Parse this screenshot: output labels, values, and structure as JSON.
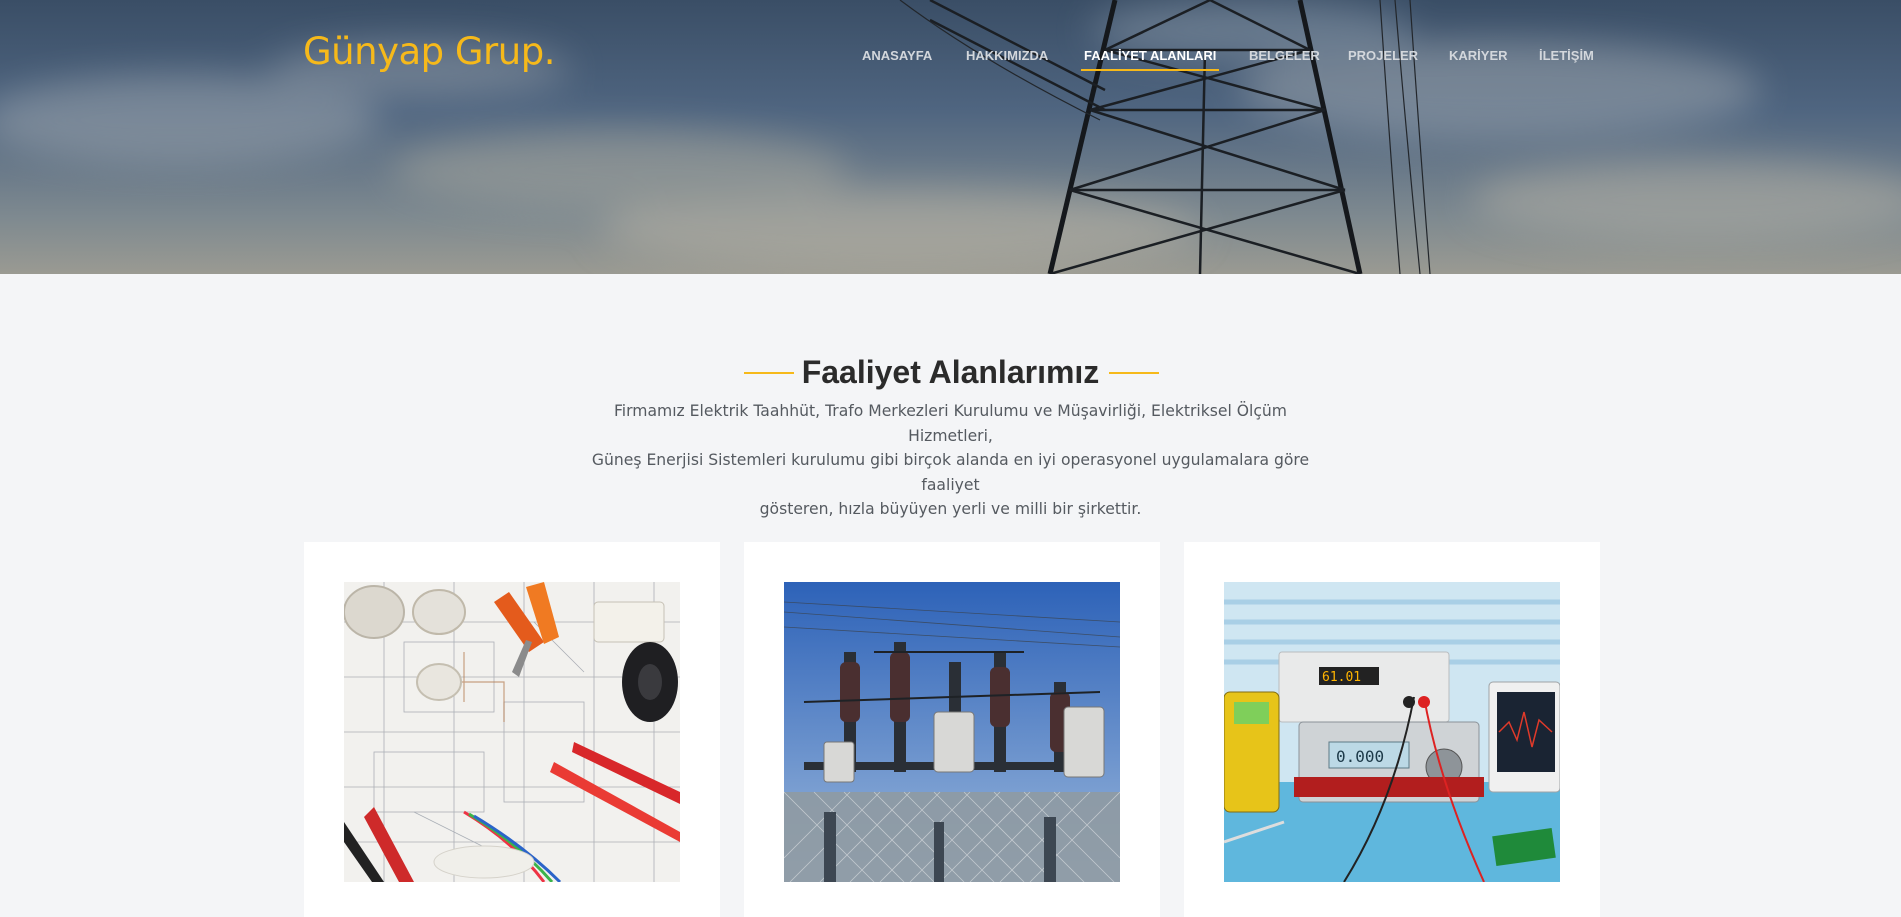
{
  "brand": {
    "logo_text": "Günyap Grup.",
    "accent_color": "#f6b91a"
  },
  "nav": {
    "items": [
      {
        "label": "ANASAYFA",
        "active": false
      },
      {
        "label": "HAKKIMIZDA",
        "active": false
      },
      {
        "label": "FAALİYET ALANLARI",
        "active": true
      },
      {
        "label": "BELGELER",
        "active": false
      },
      {
        "label": "PROJELER",
        "active": false
      },
      {
        "label": "KARİYER",
        "active": false
      },
      {
        "label": "İLETİŞİM",
        "active": false
      }
    ]
  },
  "section": {
    "title": "Faaliyet Alanlarımız",
    "description_lines": [
      "Firmamız Elektrik Taahhüt, Trafo Merkezleri Kurulumu ve Müşavirliği, Elektriksel Ölçüm Hizmetleri,",
      "Güneş Enerjisi Sistemleri kurulumu gibi birçok alanda en iyi operasyonel uygulamalara göre faaliyet",
      "gösteren, hızla büyüyen yerli ve milli bir şirkettir."
    ]
  },
  "cards": [
    {
      "image": "electrical-tools-blueprint-image"
    },
    {
      "image": "substation-transformer-image"
    },
    {
      "image": "measurement-instruments-image"
    }
  ]
}
